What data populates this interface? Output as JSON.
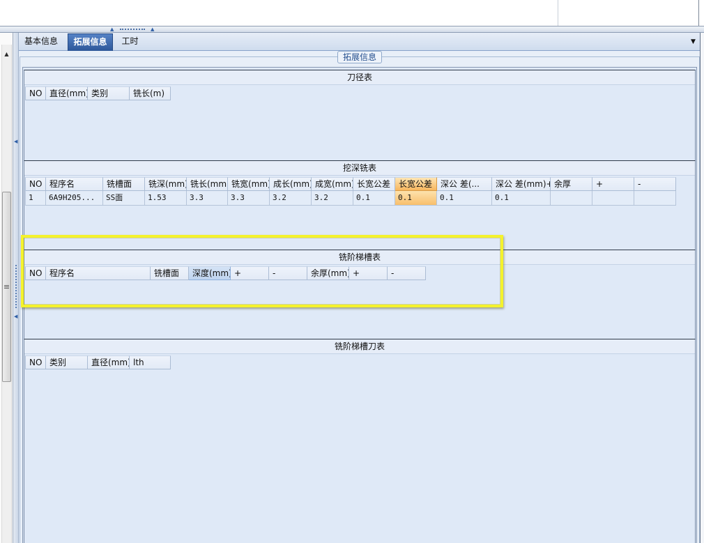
{
  "tabs": {
    "items": [
      {
        "label": "基本信息",
        "selected": false
      },
      {
        "label": "拓展信息",
        "selected": true
      },
      {
        "label": "工时",
        "selected": false
      }
    ]
  },
  "group": {
    "title": "拓展信息"
  },
  "grids": [
    {
      "title": "刀径表",
      "columns": [
        "NO",
        "直径(mm)",
        "类别",
        "铣长(m)"
      ],
      "rows": []
    },
    {
      "title": "挖深铣表",
      "columns": [
        "NO",
        "程序名",
        "铣槽面",
        "铣深(mm)",
        "铣长(mm)",
        "铣宽(mm)",
        "成长(mm)",
        "成宽(mm)",
        "长宽公差",
        "长宽公差",
        "深公 差(...",
        "深公 差(mm)+",
        "余厚",
        "+",
        "-"
      ],
      "active_column": 9,
      "rows": [
        [
          "1",
          "6A9H205...",
          "SS面",
          "1.53",
          "3.3",
          "3.3",
          "3.2",
          "3.2",
          "0.1",
          "0.1",
          "0.1",
          "0.1",
          "",
          "",
          ""
        ]
      ]
    },
    {
      "title": "铣阶梯槽表",
      "columns": [
        "NO",
        "程序名",
        "铣槽面",
        "深度(mm)",
        "+",
        "-",
        "余厚(mm)",
        "+",
        "-"
      ],
      "focused_column": 3,
      "rows": []
    },
    {
      "title": "铣阶梯槽刀表",
      "columns": [
        "NO",
        "类别",
        "直径(mm)",
        "lth"
      ],
      "rows": []
    }
  ],
  "icons": {
    "tab_menu": "chevron-down-icon",
    "scroll_up": "arrow-up-icon",
    "scrollbar_grip": "grip-lines-icon",
    "splitter_collapse_left": "triangle-left-icon",
    "splitter_collapse_up": "triangle-up-icon",
    "splitter_grip": "grip-dots-icon"
  },
  "colors": {
    "selected_tab": "#2d5799",
    "active_cell": "#f7b65e",
    "focused_header": "#bfd4ef",
    "panel_background": "#dfe9f7",
    "annotation_highlight": "#f4f22c"
  }
}
